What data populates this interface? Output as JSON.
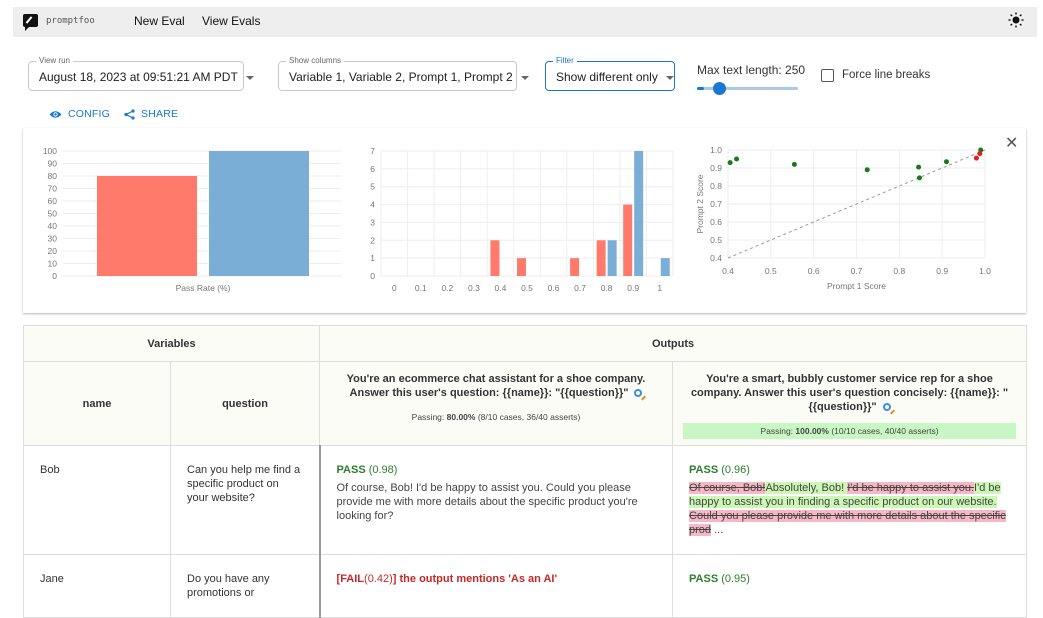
{
  "app": {
    "logo_text": "promptfoo",
    "nav": [
      "New Eval",
      "View Evals"
    ],
    "theme_icon": "sun-icon"
  },
  "controls": {
    "view_run": {
      "label": "View run",
      "value": "August 18, 2023 at 09:51:21 AM PDT"
    },
    "show_columns": {
      "label": "Show columns",
      "value": "Variable 1, Variable 2, Prompt 1, Prompt 2"
    },
    "filter": {
      "label": "Filter",
      "value": "Show different only"
    },
    "max_text_length": {
      "label": "Max text length: 250",
      "value": 250,
      "fraction": 0.07
    },
    "force_line_breaks": {
      "label": "Force line breaks",
      "checked": false
    },
    "config_label": "CONFIG",
    "share_label": "SHARE"
  },
  "colors": {
    "prompt1": "#ff7a6b",
    "prompt2": "#7aaed6",
    "accent": "#1976d2",
    "pass": "#2e7d32",
    "fail": "#c62828"
  },
  "chart_data": [
    {
      "type": "bar",
      "title": "",
      "xlabel": "Pass Rate (%)",
      "ylabel": "",
      "ylim": [
        0,
        100
      ],
      "yticks": [
        0,
        10,
        20,
        30,
        40,
        50,
        60,
        70,
        80,
        90,
        100
      ],
      "categories": [
        "Pass Rate (%)"
      ],
      "series": [
        {
          "name": "Prompt 1",
          "values": [
            80
          ]
        },
        {
          "name": "Prompt 2",
          "values": [
            100
          ]
        }
      ],
      "grid": true
    },
    {
      "type": "bar",
      "title": "",
      "xlabel": "",
      "ylabel": "",
      "ylim": [
        0,
        7
      ],
      "yticks": [
        0,
        1,
        2,
        3,
        4,
        5,
        6,
        7
      ],
      "categories": [
        "0",
        "0.1",
        "0.2",
        "0.3",
        "0.4",
        "0.5",
        "0.6",
        "0.7",
        "0.8",
        "0.9",
        "1"
      ],
      "series": [
        {
          "name": "Prompt 1",
          "values": [
            0,
            0,
            0,
            0,
            2,
            1,
            0,
            1,
            2,
            4,
            0
          ]
        },
        {
          "name": "Prompt 2",
          "values": [
            0,
            0,
            0,
            0,
            0,
            0,
            0,
            0,
            2,
            7,
            1
          ]
        }
      ],
      "grid": true
    },
    {
      "type": "scatter",
      "title": "",
      "xlabel": "Prompt 1 Score",
      "ylabel": "Prompt 2 Score",
      "xlim": [
        0.4,
        1.0
      ],
      "ylim": [
        0.4,
        1.0
      ],
      "xticks": [
        "0.4",
        "0.5",
        "0.6",
        "0.7",
        "0.8",
        "0.9",
        "1.0"
      ],
      "yticks": [
        "0.4",
        "0.5",
        "0.6",
        "0.7",
        "0.8",
        "0.9",
        "1.0"
      ],
      "points": [
        {
          "x": 0.405,
          "y": 0.93,
          "better": "prompt2"
        },
        {
          "x": 0.42,
          "y": 0.95,
          "better": "prompt2"
        },
        {
          "x": 0.555,
          "y": 0.92,
          "better": "prompt2"
        },
        {
          "x": 0.725,
          "y": 0.89,
          "better": "prompt2"
        },
        {
          "x": 0.845,
          "y": 0.905,
          "better": "prompt2"
        },
        {
          "x": 0.847,
          "y": 0.845,
          "better": "prompt2"
        },
        {
          "x": 0.91,
          "y": 0.935,
          "better": "prompt2"
        },
        {
          "x": 0.99,
          "y": 1.0,
          "better": "prompt2"
        },
        {
          "x": 0.98,
          "y": 0.955,
          "better": "prompt1"
        },
        {
          "x": 0.988,
          "y": 0.98,
          "better": "prompt1"
        }
      ],
      "reference_line": "y = x (dashed)",
      "grid": true
    }
  ],
  "table": {
    "group_headers": {
      "variables": "Variables",
      "outputs": "Outputs"
    },
    "var_headers": [
      "name",
      "question"
    ],
    "prompts": [
      {
        "text": "You're an ecommerce chat assistant for a shoe company. Answer this user's question: {{name}}: \"{{question}}\"",
        "passing_prefix": "Passing: ",
        "passing_pct": "80.00%",
        "passing_detail": " (8/10 cases, 36/40 asserts)"
      },
      {
        "text": "You're a smart, bubbly customer service rep for a shoe company. Answer this user's question concisely: {{name}}: \"{{question}}\"",
        "passing_prefix": "Passing: ",
        "passing_pct": "100.00%",
        "passing_detail": " (10/10 cases, 40/40 asserts)"
      }
    ],
    "rows": [
      {
        "name": "Bob",
        "question": "Can you help me find a specific product on your website?",
        "outputs": [
          {
            "status": "PASS",
            "score": "(0.98)",
            "text": "Of course, Bob! I'd be happy to assist you. Could you please provide me with more details about the specific product you're looking for?"
          },
          {
            "status": "PASS",
            "score": "(0.96)",
            "diff": [
              {
                "type": "del",
                "text": "Of course, Bob!"
              },
              {
                "type": "ins",
                "text": "Absolutely, Bob! "
              },
              {
                "type": "del",
                "text": "I'd be happy to assist you."
              },
              {
                "type": "ins",
                "text": "I'd be happy to assist you in finding a specific product on our website."
              },
              {
                "type": "eq",
                "text": " "
              },
              {
                "type": "del",
                "text": "Could you please provide me with more details about the specific prod"
              },
              {
                "type": "eq",
                "text": " ..."
              }
            ]
          }
        ]
      },
      {
        "name": "Jane",
        "question": "Do you have any promotions or",
        "outputs": [
          {
            "status": "FAIL",
            "score": "(0.42)",
            "reason": " the output mentions 'As an AI'"
          },
          {
            "status": "PASS",
            "score": "(0.95)"
          }
        ]
      }
    ]
  }
}
